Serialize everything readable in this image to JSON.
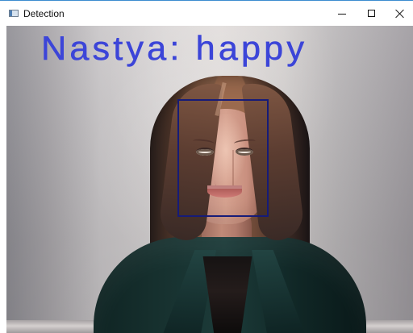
{
  "window": {
    "title": "Detection",
    "controls": {
      "minimize": "minimize",
      "maximize": "maximize",
      "close": "close"
    }
  },
  "detection": {
    "label": "Nastya: happy",
    "box_color": "#161b78",
    "label_color": "#3c45d8"
  },
  "icons": {
    "app": "app-window-icon",
    "minimize": "minimize-icon",
    "maximize": "maximize-icon",
    "close": "close-icon"
  },
  "colors": {
    "window_border": "#3c8ccf",
    "titlebar": "#ffffff",
    "jacket": "#17312f"
  }
}
